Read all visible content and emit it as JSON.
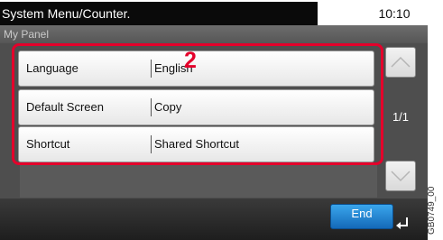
{
  "titlebar": {
    "title": "System Menu/Counter.",
    "clock": "10:10"
  },
  "subheader": {
    "label": "My Panel"
  },
  "settings": [
    {
      "label": "Language",
      "value": "English"
    },
    {
      "label": "Default Screen",
      "value": "Copy"
    },
    {
      "label": "Shortcut",
      "value": "Shared Shortcut"
    }
  ],
  "callout": {
    "number": "2",
    "color": "#e4002b"
  },
  "pager": {
    "indicator": "1/1"
  },
  "footer": {
    "end_label": "End"
  },
  "figure_id": "GB0749_00",
  "icons": {
    "scroll_up": "chevron-up-icon",
    "scroll_down": "chevron-down-icon",
    "enter": "enter-icon"
  },
  "colors": {
    "accent_button": "#1e7fd0",
    "highlight": "#e4002b"
  }
}
